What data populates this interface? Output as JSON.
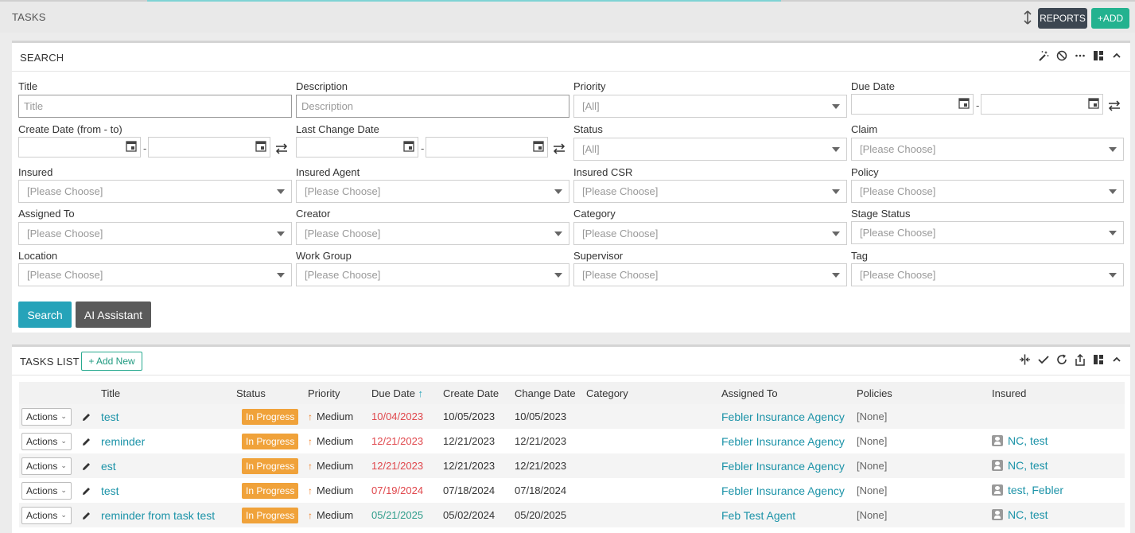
{
  "header": {
    "title": "TASKS",
    "reports_label": "REPORTS",
    "add_label": "+ADD"
  },
  "search_panel": {
    "title": "SEARCH",
    "fields": {
      "title": {
        "label": "Title",
        "placeholder": "Title"
      },
      "description": {
        "label": "Description",
        "placeholder": "Description"
      },
      "priority": {
        "label": "Priority",
        "value": "[All]"
      },
      "due_date": {
        "label": "Due Date"
      },
      "create_date": {
        "label": "Create Date (from - to)"
      },
      "last_change_date": {
        "label": "Last Change Date"
      },
      "status": {
        "label": "Status",
        "value": "[All]"
      },
      "claim": {
        "label": "Claim",
        "value": "[Please Choose]"
      },
      "insured": {
        "label": "Insured",
        "value": "[Please Choose]"
      },
      "insured_agent": {
        "label": "Insured Agent",
        "value": "[Please Choose]"
      },
      "insured_csr": {
        "label": "Insured CSR",
        "value": "[Please Choose]"
      },
      "policy": {
        "label": "Policy",
        "value": "[Please Choose]"
      },
      "assigned_to": {
        "label": "Assigned To",
        "value": "[Please Choose]"
      },
      "creator": {
        "label": "Creator",
        "value": "[Please Choose]"
      },
      "category": {
        "label": "Category",
        "value": "[Please Choose]"
      },
      "stage_status": {
        "label": "Stage Status",
        "value": "[Please Choose]"
      },
      "location": {
        "label": "Location",
        "value": "[Please Choose]"
      },
      "work_group": {
        "label": "Work Group",
        "value": "[Please Choose]"
      },
      "supervisor": {
        "label": "Supervisor",
        "value": "[Please Choose]"
      },
      "tag": {
        "label": "Tag",
        "value": "[Please Choose]"
      }
    },
    "search_label": "Search",
    "ai_label": "AI Assistant"
  },
  "tasks_list": {
    "title": "TASKS LIST",
    "add_new_label": "+ Add New",
    "columns": [
      "Title",
      "Status",
      "Priority",
      "Due Date",
      "Create Date",
      "Change Date",
      "Category",
      "Assigned To",
      "Policies",
      "Insured"
    ],
    "rows": [
      {
        "actions": "Actions",
        "title": "test",
        "status": "In Progress",
        "priority": "Medium",
        "due": "10/04/2023",
        "due_color": "red",
        "created": "10/05/2023",
        "changed": "10/05/2023",
        "category": "",
        "assigned": "Febler Insurance Agency",
        "policies": "[None]",
        "insured": ""
      },
      {
        "actions": "Actions",
        "title": "reminder",
        "status": "In Progress",
        "priority": "Medium",
        "due": "12/21/2023",
        "due_color": "red",
        "created": "12/21/2023",
        "changed": "12/21/2023",
        "category": "",
        "assigned": "Febler Insurance Agency",
        "policies": "[None]",
        "insured": "NC, test"
      },
      {
        "actions": "Actions",
        "title": "est",
        "status": "In Progress",
        "priority": "Medium",
        "due": "12/21/2023",
        "due_color": "red",
        "created": "12/21/2023",
        "changed": "12/21/2023",
        "category": "",
        "assigned": "Febler Insurance Agency",
        "policies": "[None]",
        "insured": "NC, test"
      },
      {
        "actions": "Actions",
        "title": "test",
        "status": "In Progress",
        "priority": "Medium",
        "due": "07/19/2024",
        "due_color": "red",
        "created": "07/18/2024",
        "changed": "07/18/2024",
        "category": "",
        "assigned": "Febler Insurance Agency",
        "policies": "[None]",
        "insured": "test, Febler"
      },
      {
        "actions": "Actions",
        "title": "reminder from task test",
        "status": "In Progress",
        "priority": "Medium",
        "due": "05/21/2025",
        "due_color": "green",
        "created": "05/02/2024",
        "changed": "05/20/2025",
        "category": "",
        "assigned": "Feb Test Agent",
        "policies": "[None]",
        "insured": "NC, test"
      }
    ]
  },
  "colors": {
    "accent": "#26a3b9",
    "add": "#23b28f",
    "badge": "#f0a23a",
    "overdue": "#e0474c",
    "upcoming": "#2e9c8a"
  }
}
